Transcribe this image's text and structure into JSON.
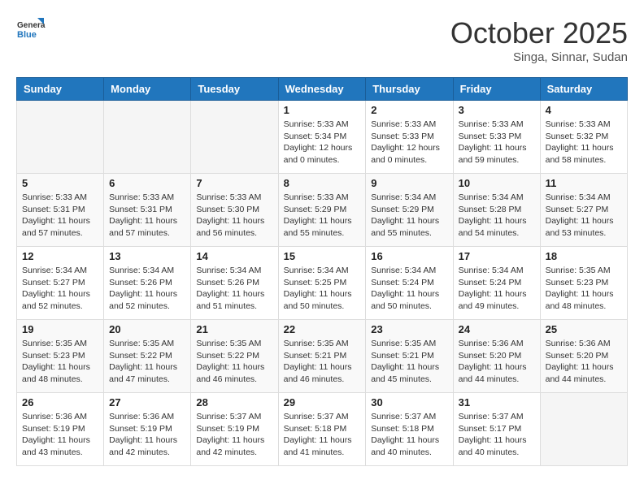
{
  "header": {
    "logo_line1": "General",
    "logo_line2": "Blue",
    "month_title": "October 2025",
    "subtitle": "Singa, Sinnar, Sudan"
  },
  "days_of_week": [
    "Sunday",
    "Monday",
    "Tuesday",
    "Wednesday",
    "Thursday",
    "Friday",
    "Saturday"
  ],
  "weeks": [
    [
      {
        "day": "",
        "info": ""
      },
      {
        "day": "",
        "info": ""
      },
      {
        "day": "",
        "info": ""
      },
      {
        "day": "1",
        "info": "Sunrise: 5:33 AM\nSunset: 5:34 PM\nDaylight: 12 hours\nand 0 minutes."
      },
      {
        "day": "2",
        "info": "Sunrise: 5:33 AM\nSunset: 5:33 PM\nDaylight: 12 hours\nand 0 minutes."
      },
      {
        "day": "3",
        "info": "Sunrise: 5:33 AM\nSunset: 5:33 PM\nDaylight: 11 hours\nand 59 minutes."
      },
      {
        "day": "4",
        "info": "Sunrise: 5:33 AM\nSunset: 5:32 PM\nDaylight: 11 hours\nand 58 minutes."
      }
    ],
    [
      {
        "day": "5",
        "info": "Sunrise: 5:33 AM\nSunset: 5:31 PM\nDaylight: 11 hours\nand 57 minutes."
      },
      {
        "day": "6",
        "info": "Sunrise: 5:33 AM\nSunset: 5:31 PM\nDaylight: 11 hours\nand 57 minutes."
      },
      {
        "day": "7",
        "info": "Sunrise: 5:33 AM\nSunset: 5:30 PM\nDaylight: 11 hours\nand 56 minutes."
      },
      {
        "day": "8",
        "info": "Sunrise: 5:33 AM\nSunset: 5:29 PM\nDaylight: 11 hours\nand 55 minutes."
      },
      {
        "day": "9",
        "info": "Sunrise: 5:34 AM\nSunset: 5:29 PM\nDaylight: 11 hours\nand 55 minutes."
      },
      {
        "day": "10",
        "info": "Sunrise: 5:34 AM\nSunset: 5:28 PM\nDaylight: 11 hours\nand 54 minutes."
      },
      {
        "day": "11",
        "info": "Sunrise: 5:34 AM\nSunset: 5:27 PM\nDaylight: 11 hours\nand 53 minutes."
      }
    ],
    [
      {
        "day": "12",
        "info": "Sunrise: 5:34 AM\nSunset: 5:27 PM\nDaylight: 11 hours\nand 52 minutes."
      },
      {
        "day": "13",
        "info": "Sunrise: 5:34 AM\nSunset: 5:26 PM\nDaylight: 11 hours\nand 52 minutes."
      },
      {
        "day": "14",
        "info": "Sunrise: 5:34 AM\nSunset: 5:26 PM\nDaylight: 11 hours\nand 51 minutes."
      },
      {
        "day": "15",
        "info": "Sunrise: 5:34 AM\nSunset: 5:25 PM\nDaylight: 11 hours\nand 50 minutes."
      },
      {
        "day": "16",
        "info": "Sunrise: 5:34 AM\nSunset: 5:24 PM\nDaylight: 11 hours\nand 50 minutes."
      },
      {
        "day": "17",
        "info": "Sunrise: 5:34 AM\nSunset: 5:24 PM\nDaylight: 11 hours\nand 49 minutes."
      },
      {
        "day": "18",
        "info": "Sunrise: 5:35 AM\nSunset: 5:23 PM\nDaylight: 11 hours\nand 48 minutes."
      }
    ],
    [
      {
        "day": "19",
        "info": "Sunrise: 5:35 AM\nSunset: 5:23 PM\nDaylight: 11 hours\nand 48 minutes."
      },
      {
        "day": "20",
        "info": "Sunrise: 5:35 AM\nSunset: 5:22 PM\nDaylight: 11 hours\nand 47 minutes."
      },
      {
        "day": "21",
        "info": "Sunrise: 5:35 AM\nSunset: 5:22 PM\nDaylight: 11 hours\nand 46 minutes."
      },
      {
        "day": "22",
        "info": "Sunrise: 5:35 AM\nSunset: 5:21 PM\nDaylight: 11 hours\nand 46 minutes."
      },
      {
        "day": "23",
        "info": "Sunrise: 5:35 AM\nSunset: 5:21 PM\nDaylight: 11 hours\nand 45 minutes."
      },
      {
        "day": "24",
        "info": "Sunrise: 5:36 AM\nSunset: 5:20 PM\nDaylight: 11 hours\nand 44 minutes."
      },
      {
        "day": "25",
        "info": "Sunrise: 5:36 AM\nSunset: 5:20 PM\nDaylight: 11 hours\nand 44 minutes."
      }
    ],
    [
      {
        "day": "26",
        "info": "Sunrise: 5:36 AM\nSunset: 5:19 PM\nDaylight: 11 hours\nand 43 minutes."
      },
      {
        "day": "27",
        "info": "Sunrise: 5:36 AM\nSunset: 5:19 PM\nDaylight: 11 hours\nand 42 minutes."
      },
      {
        "day": "28",
        "info": "Sunrise: 5:37 AM\nSunset: 5:19 PM\nDaylight: 11 hours\nand 42 minutes."
      },
      {
        "day": "29",
        "info": "Sunrise: 5:37 AM\nSunset: 5:18 PM\nDaylight: 11 hours\nand 41 minutes."
      },
      {
        "day": "30",
        "info": "Sunrise: 5:37 AM\nSunset: 5:18 PM\nDaylight: 11 hours\nand 40 minutes."
      },
      {
        "day": "31",
        "info": "Sunrise: 5:37 AM\nSunset: 5:17 PM\nDaylight: 11 hours\nand 40 minutes."
      },
      {
        "day": "",
        "info": ""
      }
    ]
  ]
}
